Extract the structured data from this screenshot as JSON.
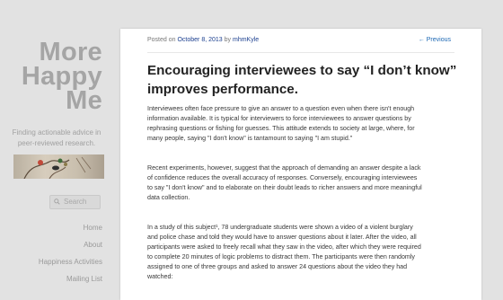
{
  "sidebar": {
    "title": [
      "More",
      "Happy",
      "Me"
    ],
    "tagline": [
      "Finding actionable advice in",
      "peer-reviewed research."
    ],
    "search_placeholder": "Search",
    "nav": [
      "Home",
      "About",
      "Happiness Activities",
      "Mailing List"
    ]
  },
  "post": {
    "meta_prefix": "Posted on",
    "date": "October 8, 2013",
    "meta_by": "by",
    "author": "mhmKyle",
    "prev_link": "← Previous",
    "title_lines": [
      "Encouraging interviewees to say “I don’t know”",
      "improves performance."
    ],
    "para1": [
      "Interviewees often face pressure to give an answer to a question even when there isn't enough",
      "information available. It is typical for interviewers to force interviewees to answer questions by",
      "rephrasing questions or fishing for guesses. This attitude extends to society at large, where, for",
      "many people, saying \"I don't know\" is tantamount to saying \"I am stupid.\""
    ],
    "para2": [
      "Recent experiments, however, suggest that the approach of demanding an answer despite a lack",
      "of confidence reduces the overall accuracy of responses. Conversely, encouraging interviewees",
      "to say \"I don't know\" and to elaborate on their doubt leads to richer answers and more meaningful",
      "data collection."
    ],
    "para3": [
      "In a study of this subject¹, 78 undergraduate students were shown a video of a violent burglary",
      "and police chase and told they would have to answer questions about it later. After the video, all",
      "participants were asked to freely recall what they saw in the video, after which they were required",
      "to complete 20 minutes of logic problems to distract them. The participants were then randomly",
      "assigned to one of three groups and asked to answer 24 questions about the video they had",
      "watched:"
    ]
  }
}
